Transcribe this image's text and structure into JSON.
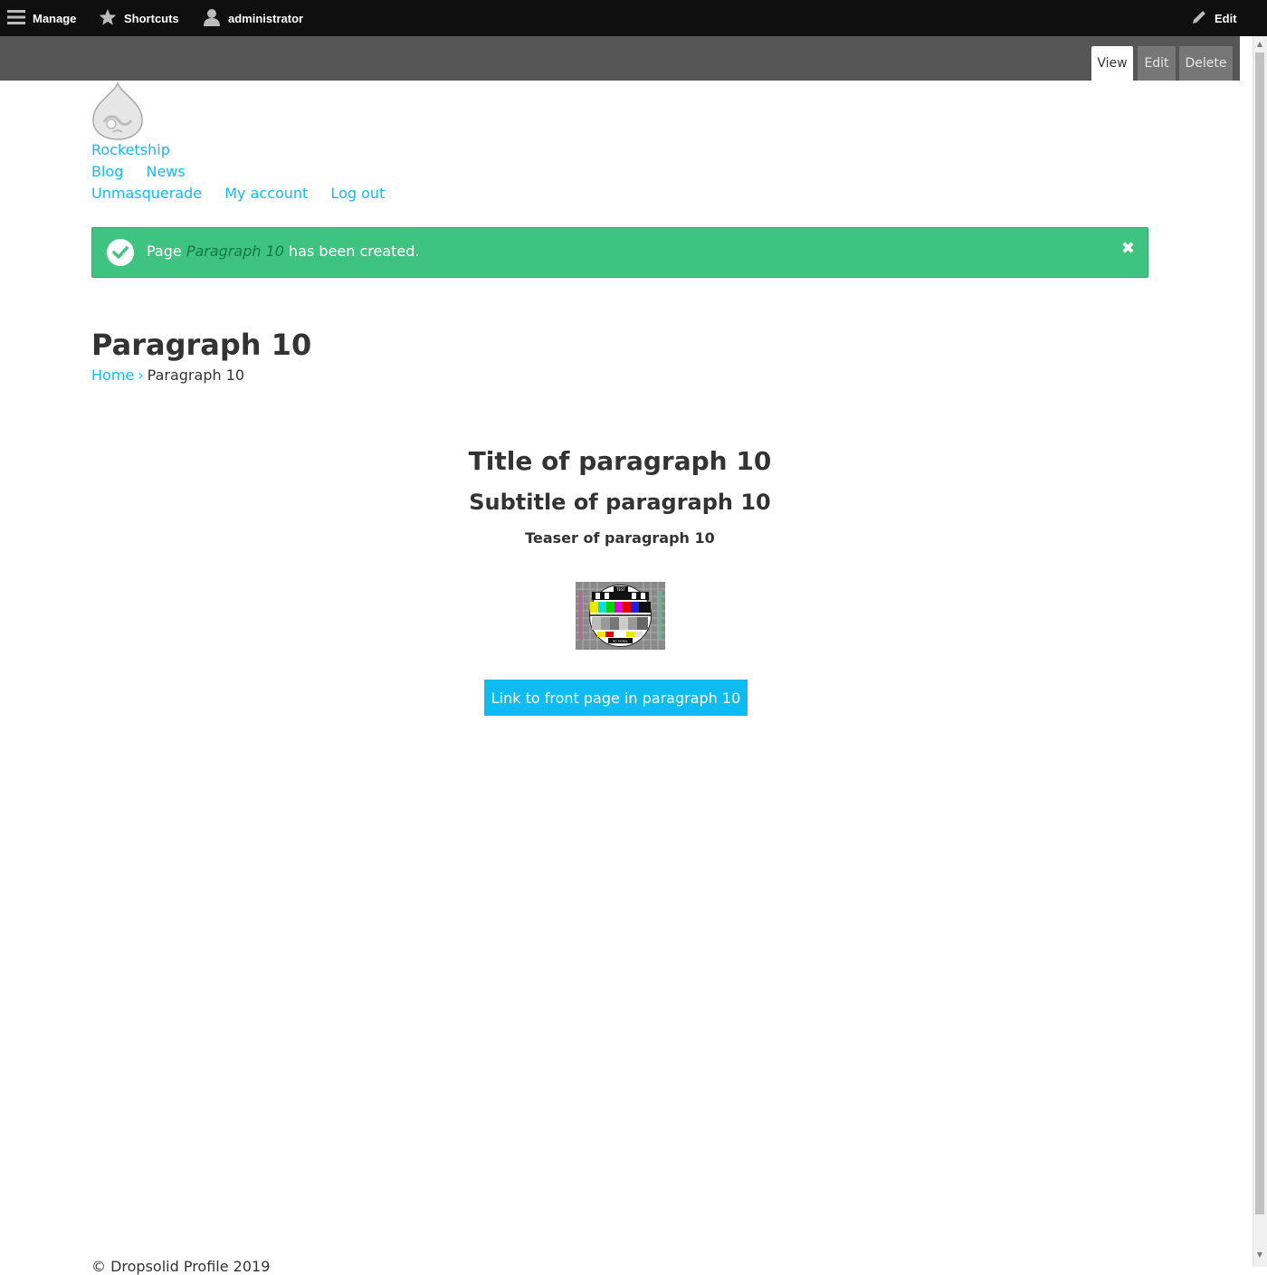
{
  "toolbar": {
    "manage": "Manage",
    "shortcuts": "Shortcuts",
    "user": "administrator",
    "edit": "Edit"
  },
  "tabs": [
    "View",
    "Edit",
    "Delete"
  ],
  "site": {
    "name": "Rocketship",
    "main_menu": [
      "Blog",
      "News"
    ],
    "account_menu": [
      "Unmasquerade",
      "My account",
      "Log out"
    ]
  },
  "message": {
    "prefix": "Page ",
    "title": "Paragraph 10",
    "suffix": " has been created.",
    "close": "✖"
  },
  "page": {
    "title": "Paragraph 10",
    "breadcrumb": {
      "home": "Home",
      "separator": "›",
      "current": "Paragraph 10"
    }
  },
  "paragraph": {
    "title": "Title of paragraph 10",
    "subtitle": "Subtitle of paragraph 10",
    "teaser": "Teaser of paragraph 10",
    "image_text_top": "TEST",
    "image_text_bottom": "NO SIGNAL",
    "button": "Link to front page in paragraph 10"
  },
  "footer": {
    "text": "© Dropsolid Profile 2019"
  },
  "colors": {
    "link": "#0ebcf2",
    "success": "#3fc380",
    "toolbar": "#0f0f0f"
  }
}
